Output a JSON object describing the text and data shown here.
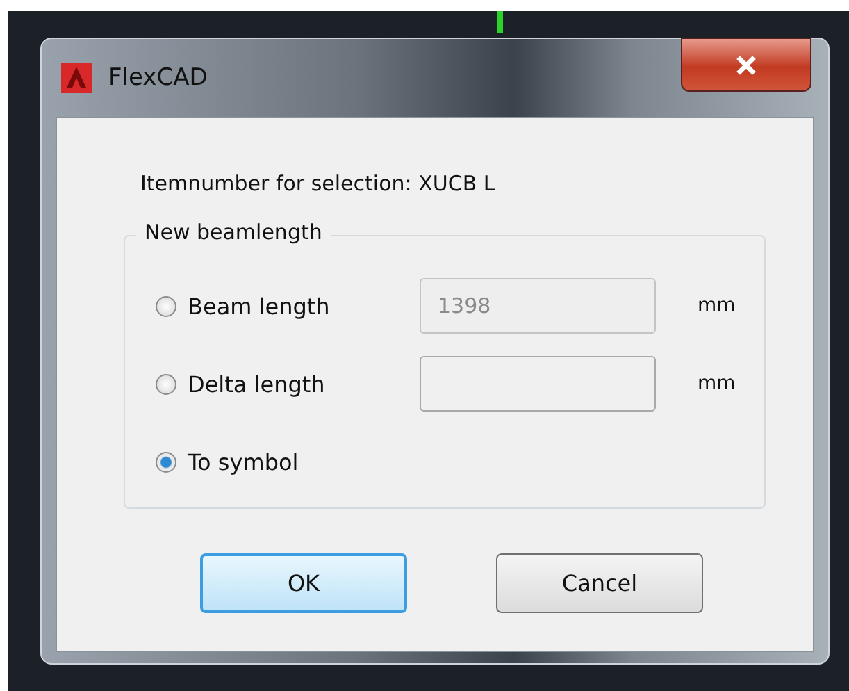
{
  "window": {
    "title": "FlexCAD"
  },
  "prompt": "Itemnumber for selection: XUCB L",
  "group": {
    "title": "New beamlength",
    "options": [
      {
        "label": "Beam length",
        "selected": false,
        "kind": "field",
        "value": "1398",
        "disabled": true,
        "unit": "mm"
      },
      {
        "label": "Delta length",
        "selected": false,
        "kind": "field",
        "disabled": false,
        "unit": "mm"
      },
      {
        "label": "To symbol",
        "selected": true,
        "kind": "plain"
      }
    ]
  },
  "buttons": [
    {
      "label": "OK",
      "default": true
    },
    {
      "label": "Cancel",
      "default": false
    }
  ]
}
